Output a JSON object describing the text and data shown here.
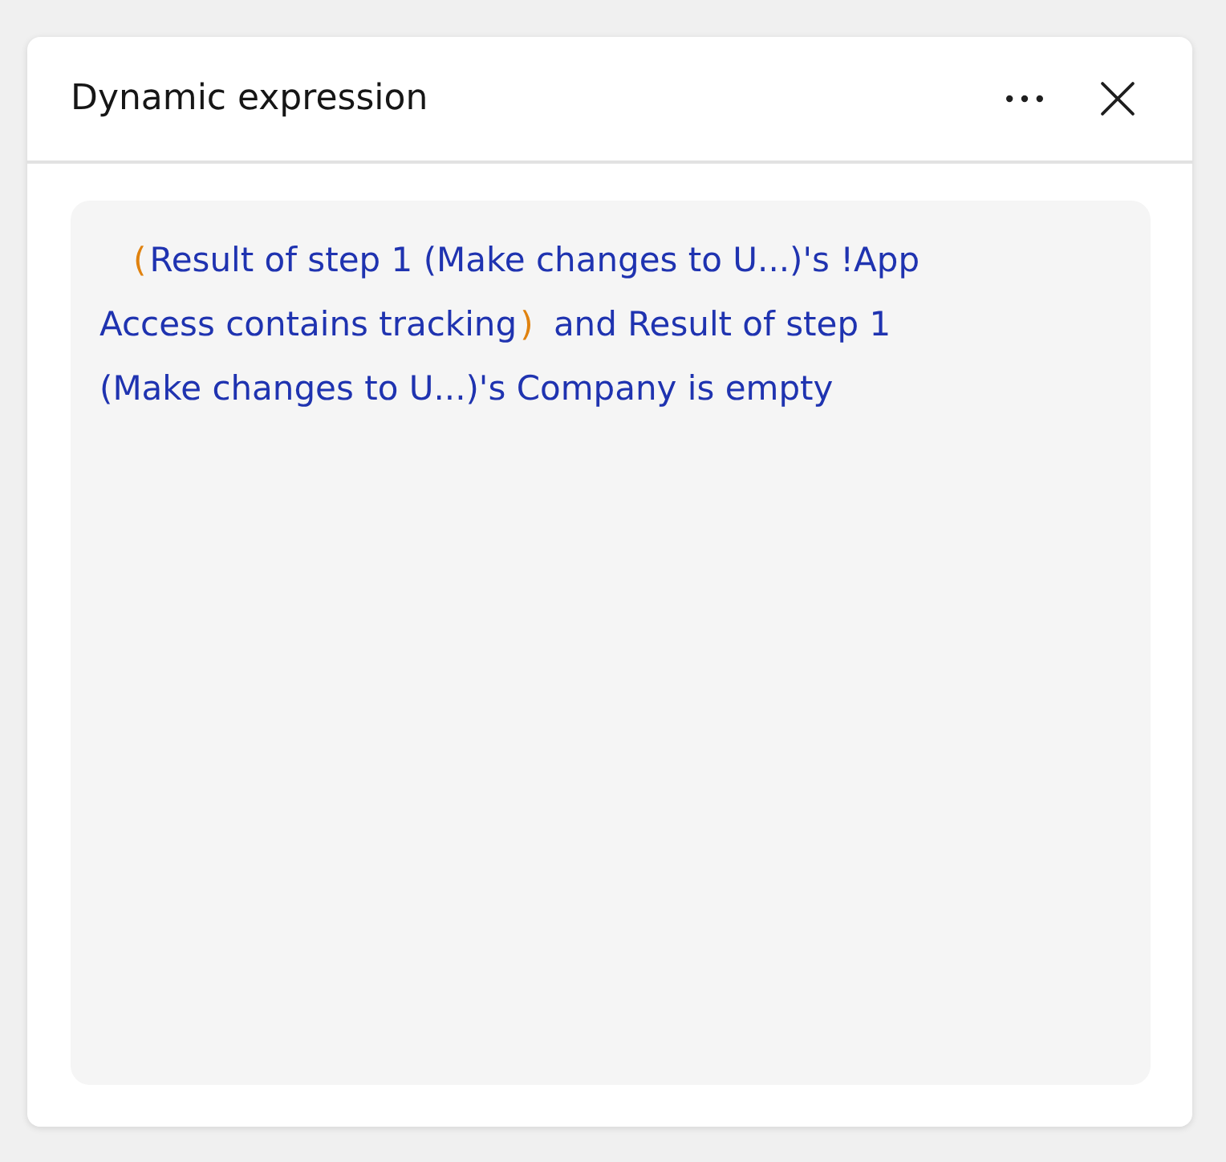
{
  "dialog": {
    "title": "Dynamic expression",
    "actions": [
      {
        "kind": "more"
      },
      {
        "kind": "close"
      }
    ]
  },
  "expression": {
    "tokens": [
      {
        "kind": "paren",
        "text": "("
      },
      {
        "kind": "text",
        "text": "Result of step 1 (Make changes to U...)'s !App Access contains tracking"
      },
      {
        "kind": "paren",
        "text": ")"
      },
      {
        "kind": "text",
        "text": " and Result of step 1 (Make changes to U...)'s Company is empty"
      }
    ]
  }
}
